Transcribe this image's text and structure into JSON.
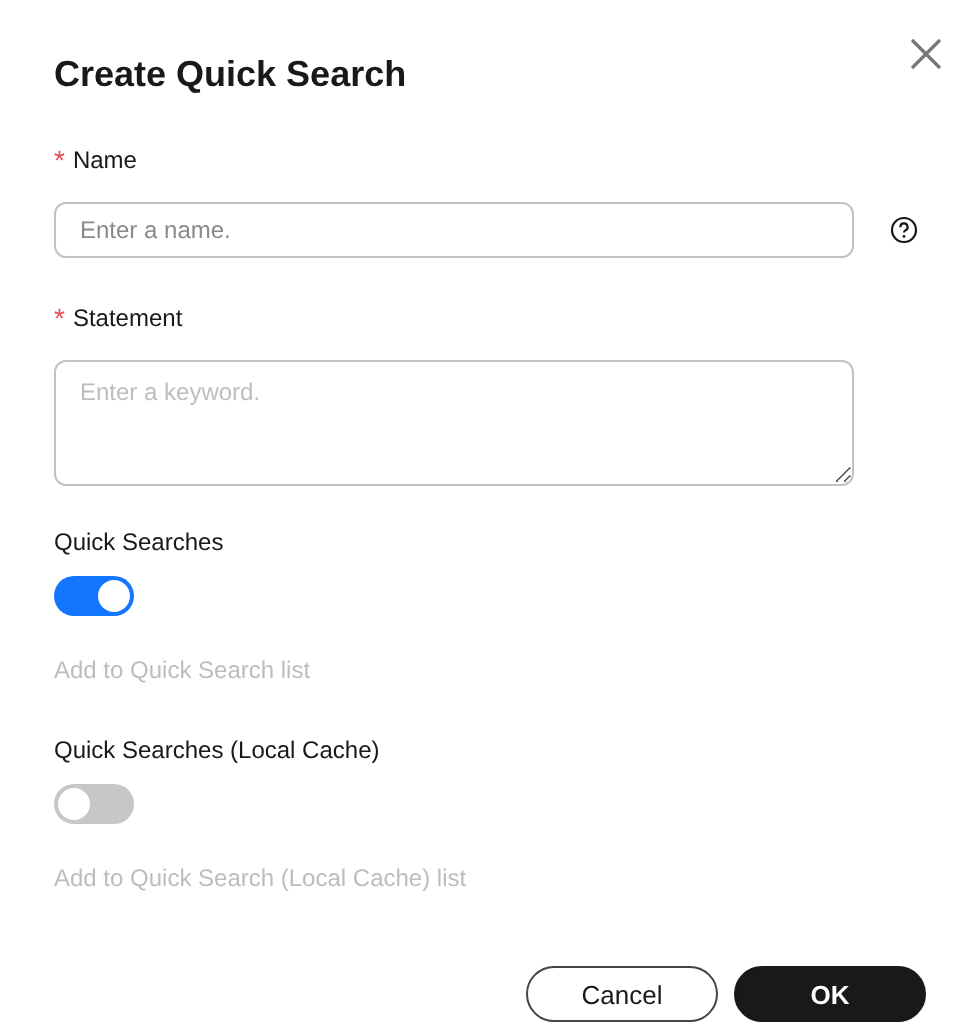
{
  "dialog": {
    "title": "Create Quick Search"
  },
  "fields": [
    {
      "kind": "input",
      "mark": "*",
      "label": "Name",
      "placeholder": "Enter a name.",
      "help": true
    },
    {
      "kind": "textarea",
      "mark": "*",
      "label": "Statement",
      "placeholder": "Enter a keyword.",
      "help": false
    }
  ],
  "switches": [
    {
      "label": "Quick Searches",
      "on": true,
      "hint": "Add to Quick Search list"
    },
    {
      "label": "Quick Searches (Local Cache)",
      "on": false,
      "hint": "Add to Quick Search (Local Cache) list"
    }
  ],
  "buttons": [
    {
      "label": "Cancel",
      "kind": "secondary"
    },
    {
      "label": "OK",
      "kind": "primary"
    }
  ]
}
